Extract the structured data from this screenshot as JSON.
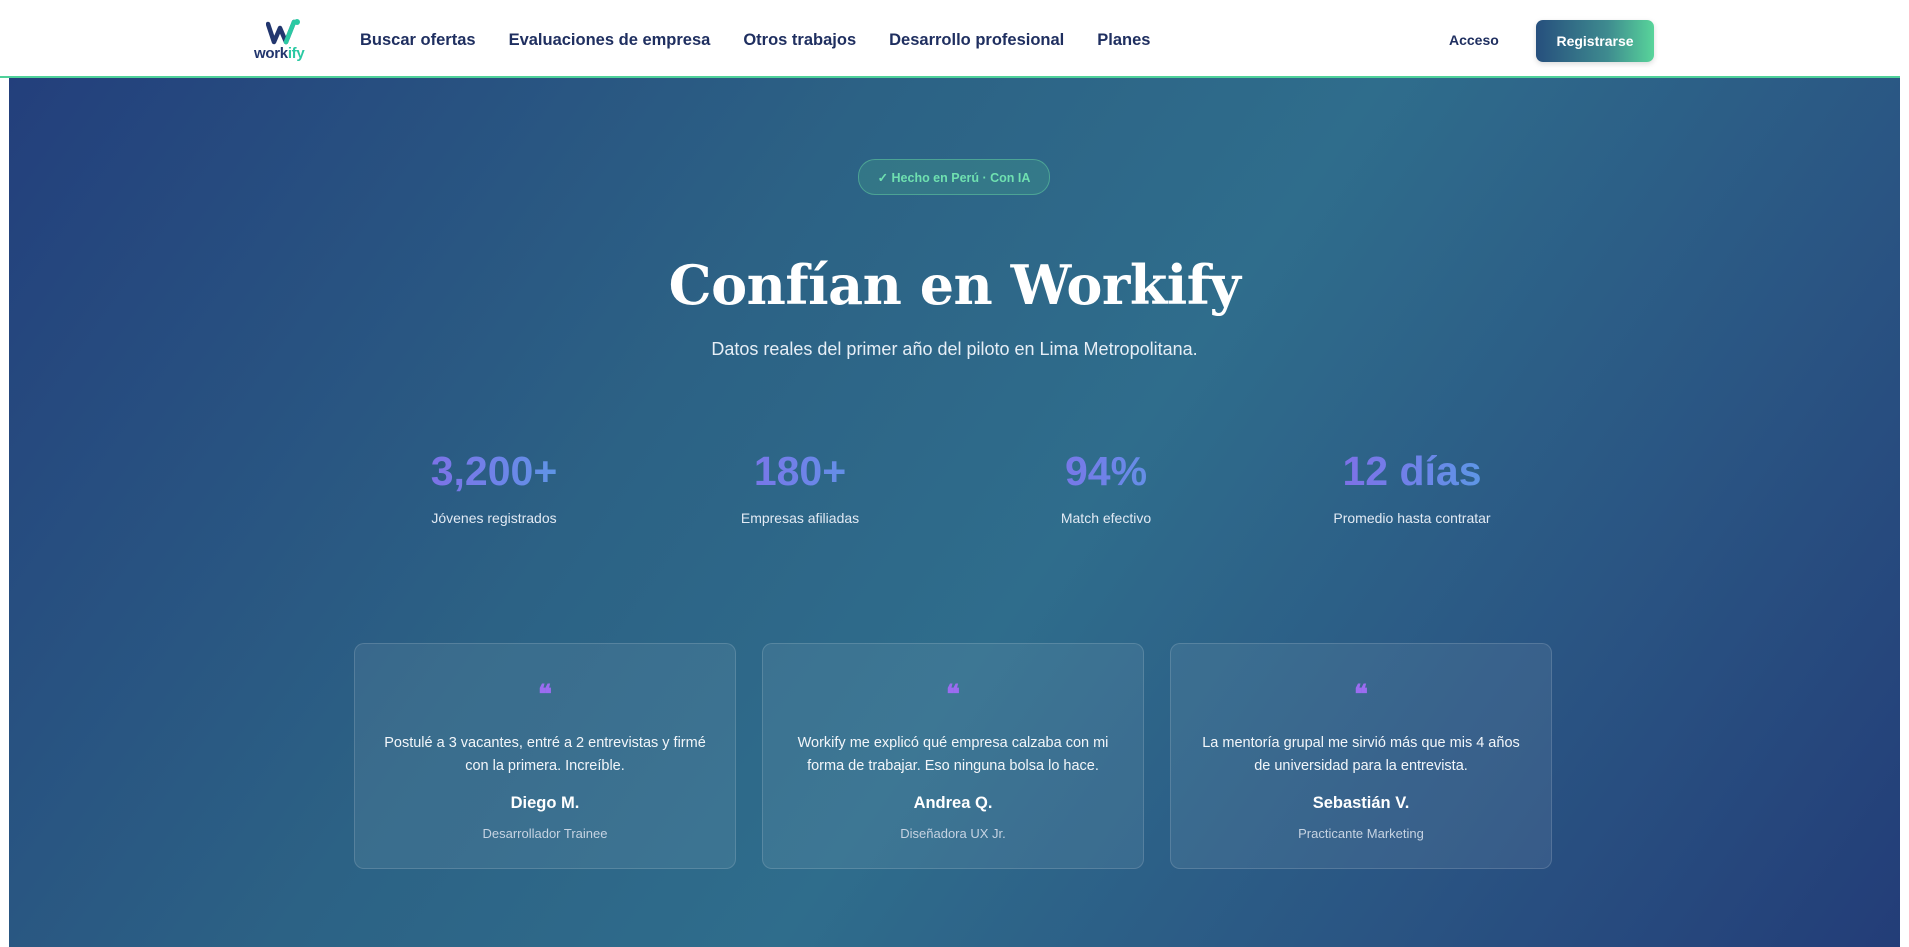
{
  "brand": {
    "logo_text_main": "work",
    "logo_text_accent": "ify"
  },
  "nav": {
    "items": [
      {
        "label": "Buscar ofertas"
      },
      {
        "label": "Evaluaciones de empresa"
      },
      {
        "label": "Otros trabajos"
      },
      {
        "label": "Desarrollo profesional"
      },
      {
        "label": "Planes"
      }
    ],
    "login_label": "Acceso",
    "register_label": "Registrarse"
  },
  "hero": {
    "badge": "✓ Hecho en Perú · Con IA",
    "title": "Confían en Workify",
    "subtitle": "Datos reales del primer año del piloto en Lima Metropolitana."
  },
  "stats": [
    {
      "value": "3,200+",
      "label": "Jóvenes registrados"
    },
    {
      "value": "180+",
      "label": "Empresas afiliadas"
    },
    {
      "value": "94%",
      "label": "Match efectivo"
    },
    {
      "value": "12 días",
      "label": "Promedio hasta contratar"
    }
  ],
  "testimonials": [
    {
      "mark": "❝",
      "quote": "Postulé a 3 vacantes, entré a 2 entrevistas y firmé con la primera. Increíble.",
      "name": "Diego M.",
      "role": "Desarrollador Trainee"
    },
    {
      "mark": "❝",
      "quote": "Workify me explicó qué empresa calzaba con mi forma de trabajar. Eso ninguna bolsa lo hace.",
      "name": "Andrea Q.",
      "role": "Diseñadora UX Jr."
    },
    {
      "mark": "❝",
      "quote": "La mentoría grupal me sirvió más que mis 4 años de universidad para la entrevista.",
      "name": "Sebastián V.",
      "role": "Practicante Marketing"
    }
  ],
  "colors": {
    "accent_green": "#4fd19a",
    "navy": "#1f2f60",
    "quote_purple": "#9b6cf0"
  }
}
